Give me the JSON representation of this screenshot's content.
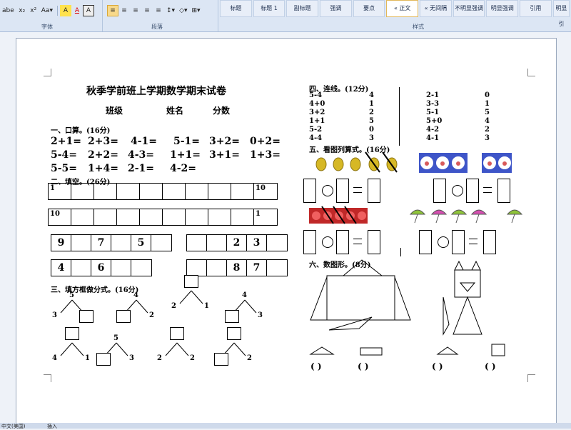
{
  "ribbon": {
    "font_buttons": [
      "abe",
      "x₂",
      "x²",
      "Aa▾",
      "A",
      "A",
      "A"
    ],
    "para_buttons": [
      "≡",
      "≡",
      "≡",
      "≡",
      "≡",
      "↕▾",
      "◇▾",
      "⊞▾"
    ],
    "group_font": "字体",
    "group_para": "段落",
    "group_styles": "样式",
    "styles": [
      "标题",
      "标题 1",
      "副标题",
      "强调",
      "要点",
      "« 正文",
      "« 无间隔",
      "不明显强调",
      "明显强调",
      "引用",
      "明显引"
    ],
    "active_style_index": 5
  },
  "doc": {
    "title": "秋季学前班上学期数学期末试卷",
    "fields": [
      "班级",
      "姓名",
      "分数"
    ],
    "s1": {
      "heading": "一、口算。(16分)",
      "rows": [
        [
          "2+1=",
          "2+3=",
          "4-1=",
          "5-1=",
          "3+2=",
          "0+2="
        ],
        [
          "5-4=",
          "2+2=",
          "4-3=",
          "1+1=",
          "3+1=",
          "1+3="
        ],
        [
          "5-5=",
          "1+4=",
          "2-1=",
          "4-2="
        ]
      ]
    },
    "s2": {
      "heading": "二、填空。(26分)",
      "row1_start": "1",
      "row1_end": "10",
      "row2_start": "10",
      "row2_end": "1",
      "seq_a": [
        "9",
        "",
        "7",
        "",
        "5",
        ""
      ],
      "seq_b": [
        "",
        "",
        "2",
        "3",
        ""
      ],
      "seq_c": [
        "4",
        "",
        "6",
        "",
        ""
      ],
      "seq_d": [
        "",
        "",
        "8",
        "7",
        ""
      ]
    },
    "s3": {
      "heading": "三、填方框做分式。(16分)",
      "trees": [
        {
          "top": "5",
          "left": "3",
          "right": ""
        },
        {
          "top": "4",
          "left": "",
          "right": "2"
        },
        {
          "top": "",
          "left": "2",
          "right": "1"
        },
        {
          "top": "4",
          "left": "",
          "right": "3"
        },
        {
          "top": "",
          "left": "4",
          "right": "1"
        },
        {
          "top": "5",
          "left": "",
          "right": "3"
        },
        {
          "top": "",
          "left": "2",
          "right": "2"
        },
        {
          "top": "",
          "left": "",
          "right": "2"
        }
      ]
    },
    "s4": {
      "heading": "四、连线。(12分)",
      "left_exprs": [
        "5-4",
        "4+0",
        "3+2",
        "1+1",
        "5-2",
        "4-4"
      ],
      "left_nums": [
        "4",
        "1",
        "2",
        "5",
        "0",
        "3"
      ],
      "right_exprs": [
        "2-1",
        "3-3",
        "5-1",
        "5+0",
        "4-2",
        "4-1"
      ],
      "right_nums": [
        "0",
        "1",
        "5",
        "4",
        "2",
        "3"
      ]
    },
    "s5": {
      "heading": "五、看图列算式。(16分)"
    },
    "s6": {
      "heading": "六、数图形。(8分)",
      "answers": [
        "(    )",
        "(    )",
        "(    )",
        "(    )"
      ]
    }
  },
  "status": {
    "lang": "中文(美国)",
    "mode": "插入"
  },
  "colors": {
    "accent": "#e2b85a",
    "ribbon": "#dce6f4",
    "page_bg": "#ffffff"
  }
}
